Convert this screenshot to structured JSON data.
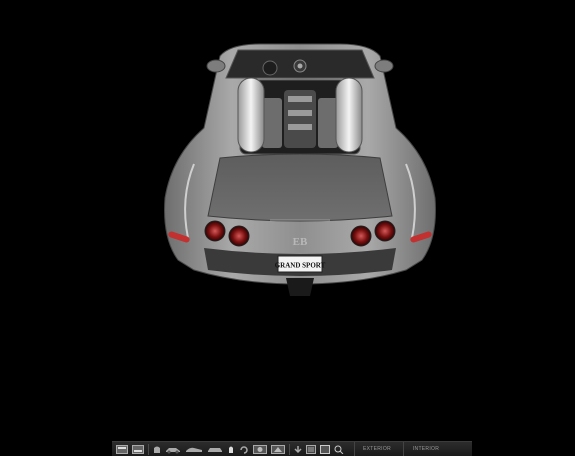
{
  "car": {
    "plate_text": "GRAND SPORT",
    "badge": "EB",
    "body_color": "#8a8a8a",
    "accent_color": "#c8c8c8"
  },
  "toolbar": {
    "icons": [
      "view-grid-icon",
      "view-list-icon",
      "front-view-icon",
      "side-view-icon",
      "side-profile-icon",
      "rear-view-icon",
      "top-view-icon",
      "rotate-icon",
      "wheel-view-icon",
      "interior-view-icon",
      "download-icon",
      "gallery-icon",
      "fullscreen-icon",
      "zoom-icon"
    ],
    "exterior_label": "EXTERIOR",
    "interior_label": "INTERIOR"
  }
}
